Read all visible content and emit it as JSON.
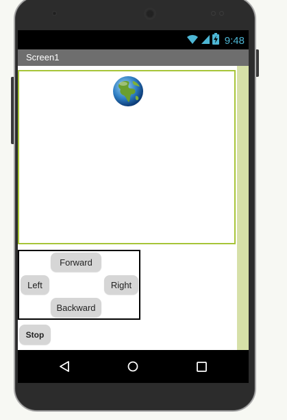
{
  "status_bar": {
    "time": "9:48",
    "icons": [
      "wifi-icon",
      "signal-icon",
      "battery-charging-icon"
    ],
    "time_color": "#4db6d4"
  },
  "app": {
    "screen_title": "Screen1",
    "title_bar_color": "#6e6e6e",
    "canvas_border_color": "#a6c437",
    "scroll_track_color": "#d6e0a8"
  },
  "canvas": {
    "sprite_icon": "globe-icon"
  },
  "controls": {
    "forward_label": "Forward",
    "left_label": "Left",
    "right_label": "Right",
    "backward_label": "Backward",
    "stop_label": "Stop"
  },
  "nav_bar": {
    "icons": [
      "back-icon",
      "home-icon",
      "recent-apps-icon"
    ]
  }
}
